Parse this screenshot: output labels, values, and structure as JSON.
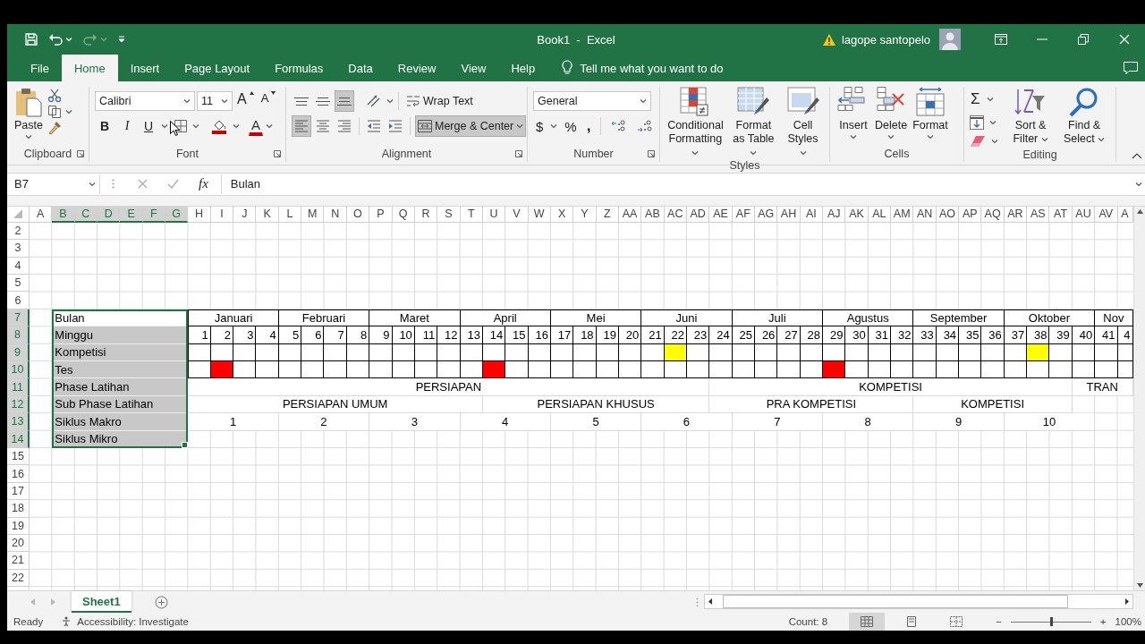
{
  "title_bar": {
    "title": "Book1  -  Excel",
    "user": "lagope santopelo"
  },
  "tabs": {
    "items": [
      {
        "label": "File",
        "selected": false
      },
      {
        "label": "Home",
        "selected": true
      },
      {
        "label": "Insert",
        "selected": false
      },
      {
        "label": "Page Layout",
        "selected": false
      },
      {
        "label": "Formulas",
        "selected": false
      },
      {
        "label": "Data",
        "selected": false
      },
      {
        "label": "Review",
        "selected": false
      },
      {
        "label": "View",
        "selected": false
      },
      {
        "label": "Help",
        "selected": false
      }
    ],
    "tell_me": "Tell me what you want to do"
  },
  "ribbon": {
    "clipboard": {
      "paste": "Paste",
      "label": "Clipboard"
    },
    "font": {
      "name": "Calibri",
      "size": "11",
      "grow": "A",
      "shrink": "A",
      "bold": "B",
      "italic": "I",
      "underline": "U",
      "font_color": "A",
      "label": "Font"
    },
    "alignment": {
      "vertical": [
        {
          "on": false
        },
        {
          "on": false
        },
        {
          "on": true
        }
      ],
      "horizontal": [
        {
          "on": true
        },
        {
          "on": false
        },
        {
          "on": false
        }
      ],
      "wrap": "Wrap Text",
      "merge": {
        "label": "Merge & Center",
        "on": true
      },
      "label": "Alignment"
    },
    "number": {
      "format": "General",
      "currency": "$",
      "percent": "%",
      "comma": ",",
      "label": "Number"
    },
    "styles": {
      "buttons": [
        "Conditional Formatting",
        "Format as Table",
        "Cell Styles"
      ],
      "label": "Styles"
    },
    "cells": {
      "buttons": [
        "Insert",
        "Delete",
        "Format"
      ],
      "label": "Cells"
    },
    "editing": {
      "autosum": "Σ",
      "buttons": [
        "Sort & Filter",
        "Find & Select"
      ],
      "label": "Editing"
    }
  },
  "formula_bar": {
    "name_box": "B7",
    "fx": "fx",
    "formula": "Bulan"
  },
  "sheet": {
    "columns": [
      {
        "text": "A",
        "selected": false
      },
      {
        "text": "B",
        "selected": true
      },
      {
        "text": "C",
        "selected": true
      },
      {
        "text": "D",
        "selected": true
      },
      {
        "text": "E",
        "selected": true
      },
      {
        "text": "F",
        "selected": true
      },
      {
        "text": "G",
        "selected": true
      },
      {
        "text": "H",
        "selected": false
      },
      {
        "text": "I",
        "selected": false
      },
      {
        "text": "J",
        "selected": false
      },
      {
        "text": "K",
        "selected": false
      },
      {
        "text": "L",
        "selected": false
      },
      {
        "text": "M",
        "selected": false
      },
      {
        "text": "N",
        "selected": false
      },
      {
        "text": "O",
        "selected": false
      },
      {
        "text": "P",
        "selected": false
      },
      {
        "text": "Q",
        "selected": false
      },
      {
        "text": "R",
        "selected": false
      },
      {
        "text": "S",
        "selected": false
      },
      {
        "text": "T",
        "selected": false
      },
      {
        "text": "U",
        "selected": false
      },
      {
        "text": "V",
        "selected": false
      },
      {
        "text": "W",
        "selected": false
      },
      {
        "text": "X",
        "selected": false
      },
      {
        "text": "Y",
        "selected": false
      },
      {
        "text": "Z",
        "selected": false
      },
      {
        "text": "AA",
        "selected": false
      },
      {
        "text": "AB",
        "selected": false
      },
      {
        "text": "AC",
        "selected": false
      },
      {
        "text": "AD",
        "selected": false
      },
      {
        "text": "AE",
        "selected": false
      },
      {
        "text": "AF",
        "selected": false
      },
      {
        "text": "AG",
        "selected": false
      },
      {
        "text": "AH",
        "selected": false
      },
      {
        "text": "AI",
        "selected": false
      },
      {
        "text": "AJ",
        "selected": false
      },
      {
        "text": "AK",
        "selected": false
      },
      {
        "text": "AL",
        "selected": false
      },
      {
        "text": "AM",
        "selected": false
      },
      {
        "text": "AN",
        "selected": false
      },
      {
        "text": "AO",
        "selected": false
      },
      {
        "text": "AP",
        "selected": false
      },
      {
        "text": "AQ",
        "selected": false
      },
      {
        "text": "AR",
        "selected": false
      },
      {
        "text": "AS",
        "selected": false
      },
      {
        "text": "AT",
        "selected": false
      },
      {
        "text": "AU",
        "selected": false
      },
      {
        "text": "AV",
        "selected": false
      },
      {
        "text": "A",
        "selected": false
      }
    ],
    "rows": [
      {
        "header": {
          "text": "2",
          "selected": false
        }
      },
      {
        "header": {
          "text": "3",
          "selected": false
        }
      },
      {
        "header": {
          "text": "4",
          "selected": false
        }
      },
      {
        "header": {
          "text": "5",
          "selected": false
        }
      },
      {
        "header": {
          "text": "6",
          "selected": false
        }
      },
      {
        "header": {
          "text": "7",
          "selected": true
        },
        "label": {
          "text": "Bulan",
          "selected": true,
          "active": true
        },
        "kind": "header",
        "cells": [
          {
            "text": "Januari"
          },
          null,
          null,
          null,
          {
            "text": "Februari"
          },
          null,
          null,
          null,
          {
            "text": "Maret"
          },
          null,
          null,
          null,
          {
            "text": "April"
          },
          null,
          null,
          null,
          {
            "text": "Mei"
          },
          null,
          null,
          null,
          {
            "text": "Juni"
          },
          null,
          null,
          null,
          {
            "text": "Juli"
          },
          null,
          null,
          null,
          {
            "text": "Agustus"
          },
          null,
          null,
          null,
          {
            "text": "September"
          },
          null,
          null,
          null,
          {
            "text": "Oktober"
          },
          null,
          null,
          null,
          {
            "text": "Nov"
          },
          null
        ]
      },
      {
        "header": {
          "text": "8",
          "selected": true
        },
        "label": {
          "text": "Minggu",
          "selected": true,
          "active": false
        },
        "kind": "numbers",
        "cells": [
          {
            "text": "1"
          },
          {
            "text": "2"
          },
          {
            "text": "3"
          },
          {
            "text": "4"
          },
          {
            "text": "5"
          },
          {
            "text": "6"
          },
          {
            "text": "7"
          },
          {
            "text": "8"
          },
          {
            "text": "9"
          },
          {
            "text": "10"
          },
          {
            "text": "11"
          },
          {
            "text": "12"
          },
          {
            "text": "13"
          },
          {
            "text": "14"
          },
          {
            "text": "15"
          },
          {
            "text": "16"
          },
          {
            "text": "17"
          },
          {
            "text": "18"
          },
          {
            "text": "19"
          },
          {
            "text": "20"
          },
          {
            "text": "21"
          },
          {
            "text": "22"
          },
          {
            "text": "23"
          },
          {
            "text": "24"
          },
          {
            "text": "25"
          },
          {
            "text": "26"
          },
          {
            "text": "27"
          },
          {
            "text": "28"
          },
          {
            "text": "29"
          },
          {
            "text": "30"
          },
          {
            "text": "31"
          },
          {
            "text": "32"
          },
          {
            "text": "33"
          },
          {
            "text": "34"
          },
          {
            "text": "35"
          },
          {
            "text": "36"
          },
          {
            "text": "37"
          },
          {
            "text": "38"
          },
          {
            "text": "39"
          },
          {
            "text": "40"
          },
          {
            "text": "41"
          },
          {
            "text": "4"
          }
        ]
      },
      {
        "header": {
          "text": "9",
          "selected": true
        },
        "label": {
          "text": "Kompetisi",
          "selected": true,
          "active": false
        },
        "kind": "marks",
        "cells": [
          {},
          {},
          {},
          {},
          {},
          {},
          {},
          {},
          {},
          {},
          {},
          {},
          {},
          {},
          {},
          {},
          {},
          {},
          {},
          {},
          {},
          {
            "color": "#ffff00"
          },
          {},
          {},
          {},
          {},
          {},
          {},
          {},
          {},
          {},
          {},
          {},
          {},
          {},
          {},
          {},
          {
            "color": "#ffff00"
          },
          {},
          {},
          {},
          {}
        ]
      },
      {
        "header": {
          "text": "10",
          "selected": true
        },
        "label": {
          "text": "Tes",
          "selected": true,
          "active": false
        },
        "kind": "marks",
        "cells": [
          {},
          {
            "color": "#ff0000"
          },
          {},
          {},
          {},
          {},
          {},
          {},
          {},
          {},
          {},
          {},
          {},
          {
            "color": "#ff0000"
          },
          {},
          {},
          {},
          {},
          {},
          {},
          {},
          {},
          {},
          {},
          {},
          {},
          {},
          {},
          {
            "color": "#ff0000"
          },
          {},
          {},
          {},
          {},
          {},
          {},
          {},
          {},
          {},
          {},
          {},
          {},
          {}
        ]
      },
      {
        "header": {
          "text": "11",
          "selected": true
        },
        "label": {
          "text": "Phase Latihan",
          "selected": true,
          "active": false
        },
        "kind": "merged",
        "cells": [
          {
            "text": "PERSIAPAN"
          },
          null,
          null,
          null,
          null,
          null,
          null,
          null,
          null,
          null,
          null,
          null,
          null,
          null,
          null,
          null,
          null,
          null,
          null,
          null,
          null,
          null,
          null,
          {
            "text": "KOMPETISI"
          },
          null,
          null,
          null,
          null,
          null,
          null,
          null,
          null,
          null,
          null,
          null,
          null,
          null,
          null,
          null,
          {
            "text": "TRAN"
          },
          null,
          null
        ]
      },
      {
        "header": {
          "text": "12",
          "selected": true
        },
        "label": {
          "text": "Sub Phase Latihan",
          "selected": true,
          "active": false
        },
        "kind": "merged",
        "cells": [
          {
            "text": "PERSIAPAN UMUM"
          },
          null,
          null,
          null,
          null,
          null,
          null,
          null,
          null,
          null,
          null,
          null,
          null,
          {
            "text": "PERSIAPAN KHUSUS"
          },
          null,
          null,
          null,
          null,
          null,
          null,
          null,
          null,
          null,
          {
            "text": "PRA KOMPETISI"
          },
          null,
          null,
          null,
          null,
          null,
          null,
          null,
          null,
          {
            "text": "KOMPETISI"
          },
          null,
          null,
          null,
          null,
          null,
          null,
          {},
          {},
          {}
        ]
      },
      {
        "header": {
          "text": "13",
          "selected": true
        },
        "label": {
          "text": "Siklus Makro",
          "selected": true,
          "active": false
        },
        "kind": "merged",
        "cells": [
          {
            "text": "1"
          },
          null,
          null,
          null,
          {
            "text": "2"
          },
          null,
          null,
          null,
          {
            "text": "3"
          },
          null,
          null,
          null,
          {
            "text": "4"
          },
          null,
          null,
          null,
          {
            "text": "5"
          },
          null,
          null,
          null,
          {
            "text": "6"
          },
          null,
          null,
          null,
          {
            "text": "7"
          },
          null,
          null,
          null,
          {
            "text": "8"
          },
          null,
          null,
          null,
          {
            "text": "9"
          },
          null,
          null,
          null,
          {
            "text": "10"
          },
          null,
          null,
          null,
          {},
          {}
        ]
      },
      {
        "header": {
          "text": "14",
          "selected": true
        },
        "label": {
          "text": "Siklus Mikro",
          "selected": true,
          "active": false
        }
      },
      {
        "header": {
          "text": "15",
          "selected": false
        }
      },
      {
        "header": {
          "text": "16",
          "selected": false
        }
      },
      {
        "header": {
          "text": "17",
          "selected": false
        }
      },
      {
        "header": {
          "text": "18",
          "selected": false
        }
      },
      {
        "header": {
          "text": "19",
          "selected": false
        }
      },
      {
        "header": {
          "text": "20",
          "selected": false
        }
      },
      {
        "header": {
          "text": "21",
          "selected": false
        }
      },
      {
        "header": {
          "text": "22",
          "selected": false
        }
      }
    ]
  },
  "sheet_tabs": [
    {
      "name": "Sheet1",
      "selected": true
    }
  ],
  "status_bar": {
    "ready": "Ready",
    "accessibility": "Accessibility: Investigate",
    "count": "Count: 8",
    "views": [
      {
        "selected": true
      },
      {
        "selected": false
      },
      {
        "selected": false
      }
    ],
    "zoom": {
      "out": "−",
      "in": "+",
      "level": 0.5,
      "percent": "100%"
    }
  }
}
